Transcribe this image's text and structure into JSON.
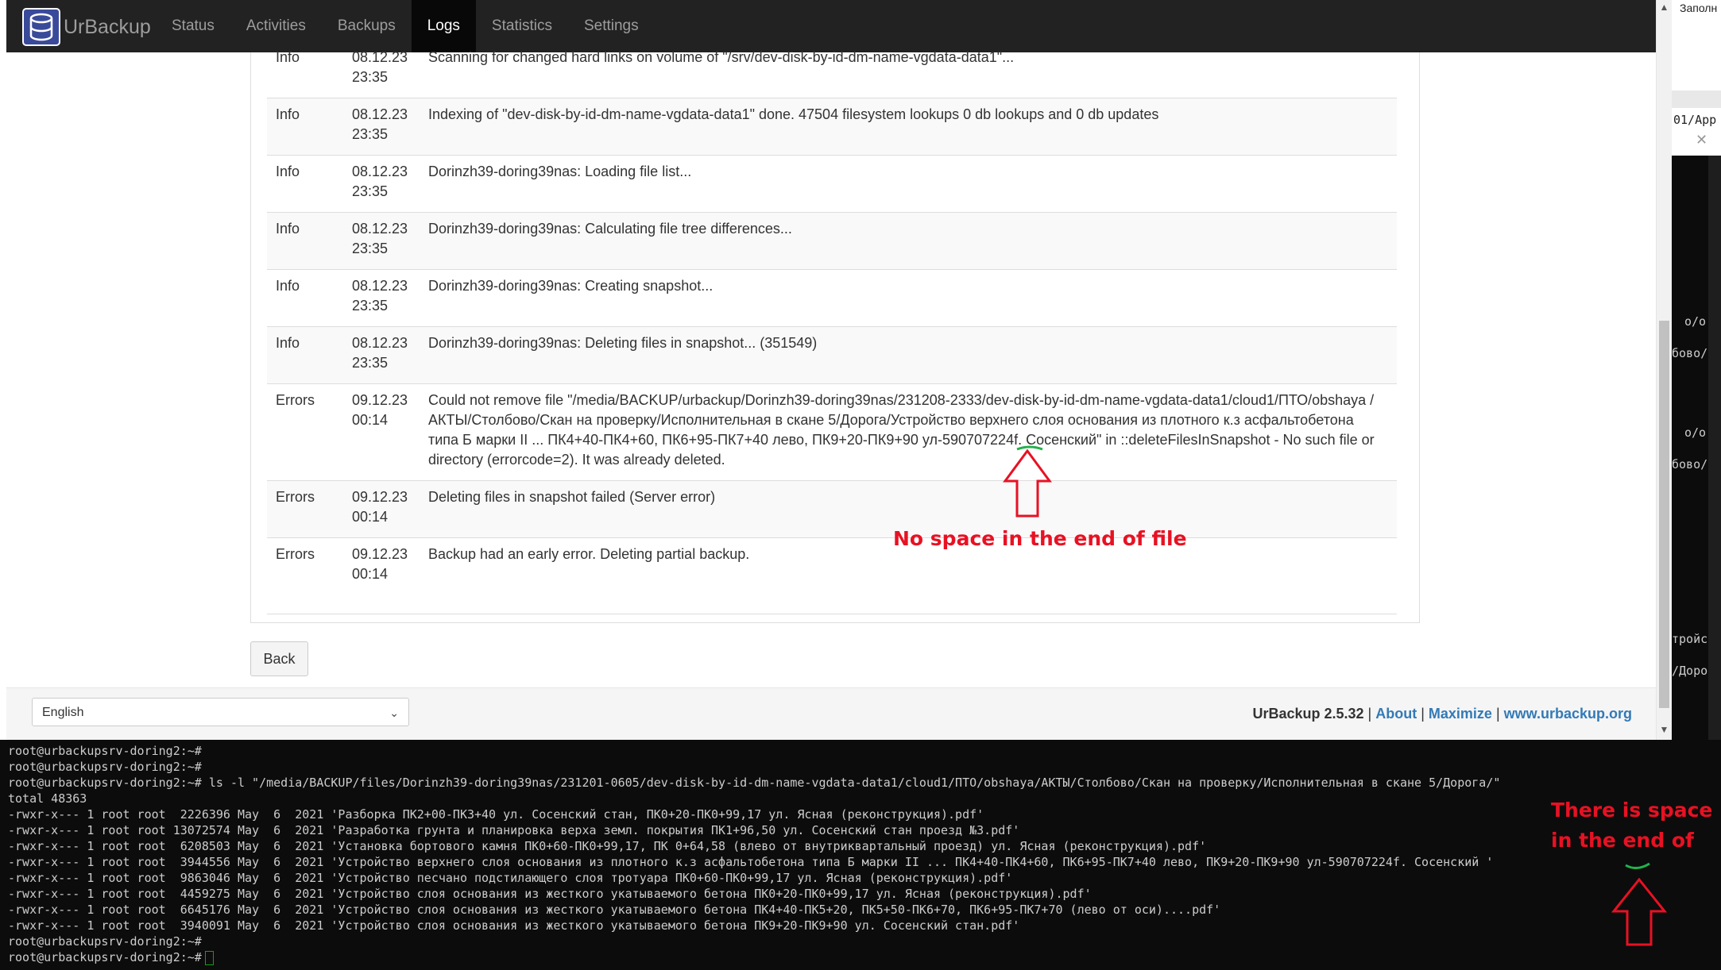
{
  "browser": {
    "brand": "UrBackup",
    "nav": [
      "Status",
      "Activities",
      "Backups",
      "Logs",
      "Statistics",
      "Settings"
    ],
    "active_nav": "Logs",
    "logs": [
      {
        "type": "Info",
        "date": "08.12.23",
        "time": "23:35",
        "message": "Scanning for changed hard links on volume of \"/srv/dev-disk-by-id-dm-name-vgdata-data1\"..."
      },
      {
        "type": "Info",
        "date": "08.12.23",
        "time": "23:35",
        "message": "Indexing of \"dev-disk-by-id-dm-name-vgdata-data1\" done. 47504 filesystem lookups 0 db lookups and 0 db updates"
      },
      {
        "type": "Info",
        "date": "08.12.23",
        "time": "23:35",
        "message": "Dorinzh39-doring39nas: Loading file list..."
      },
      {
        "type": "Info",
        "date": "08.12.23",
        "time": "23:35",
        "message": "Dorinzh39-doring39nas: Calculating file tree differences..."
      },
      {
        "type": "Info",
        "date": "08.12.23",
        "time": "23:35",
        "message": "Dorinzh39-doring39nas: Creating snapshot..."
      },
      {
        "type": "Info",
        "date": "08.12.23",
        "time": "23:35",
        "message": "Dorinzh39-doring39nas: Deleting files in snapshot... (351549)"
      },
      {
        "type": "Errors",
        "date": "09.12.23",
        "time": "00:14",
        "message": "Could not remove file \"/media/BACKUP/urbackup/Dorinzh39-doring39nas/231208-2333/dev-disk-by-id-dm-name-vgdata-data1/cloud1/ПТО/obshaya /АКТЫ/Столбово/Скан на проверку/Исполнительная в скане 5/Дорога/Устройство верхнего слоя основания из плотного к.з асфальтобетона типа Б марки II ... ПК4+40-ПК4+60, ПК6+95-ПК7+40 лево, ПК9+20-ПК9+90 ул-590707224f. Сосенский\" in ::deleteFilesInSnapshot - No such file or directory (errorcode=2). It was already deleted."
      },
      {
        "type": "Errors",
        "date": "09.12.23",
        "time": "00:14",
        "message": "Deleting files in snapshot failed (Server error)"
      },
      {
        "type": "Errors",
        "date": "09.12.23",
        "time": "00:14",
        "message": "Backup had an early error. Deleting partial backup."
      }
    ],
    "back_label": "Back",
    "language": "English",
    "footer": {
      "version": "UrBackup 2.5.32",
      "sep": " | ",
      "about": "About",
      "maximize": "Maximize",
      "site": "www.urbackup.org"
    }
  },
  "right_window": {
    "top_text": "Заполн",
    "path_text": "01/App",
    "fragments": [
      "о/о",
      "бово/",
      "о/о",
      "бово/",
      "тройс",
      "/Доро"
    ]
  },
  "terminal": {
    "lines": [
      "root@urbackupsrv-doring2:~#",
      "root@urbackupsrv-doring2:~#",
      "root@urbackupsrv-doring2:~# ls -l \"/media/BACKUP/files/Dorinzh39-doring39nas/231201-0605/dev-disk-by-id-dm-name-vgdata-data1/cloud1/ПТО/obshaya/АКТЫ/Столбово/Скан на проверку/Исполнительная в скане 5/Дорога/\"",
      "total 48363",
      "-rwxr-x--- 1 root root  2226396 May  6  2021 'Разборка ПК2+00-ПК3+40 ул. Сосенский стан, ПК0+20-ПК0+99,17 ул. Ясная (реконструкция).pdf'",
      "-rwxr-x--- 1 root root 13072574 May  6  2021 'Разработка грунта и планировка верха земл. покрытия ПК1+96,50 ул. Сосенский стан проезд №3.pdf'",
      "-rwxr-x--- 1 root root  6208503 May  6  2021 'Установка бортового камня ПК0+60-ПК0+99,17, ПК 0+64,58 (влево от внутриквартальный проезд) ул. Ясная (реконструкция).pdf'",
      "-rwxr-x--- 1 root root  3944556 May  6  2021 'Устройство верхнего слоя основания из плотного к.з асфальтобетона типа Б марки II ... ПК4+40-ПК4+60, ПК6+95-ПК7+40 лево, ПК9+20-ПК9+90 ул-590707224f. Сосенский '",
      "-rwxr-x--- 1 root root  9863046 May  6  2021 'Устройство песчано подстилающего слоя тротуара ПК0+60-ПК0+99,17 ул. Ясная (реконструкция).pdf'",
      "-rwxr-x--- 1 root root  4459275 May  6  2021 'Устройство слоя основания из жесткого укатываемого бетона ПК0+20-ПК0+99,17 ул. Ясная (реконструкция).pdf'",
      "-rwxr-x--- 1 root root  6645176 May  6  2021 'Устройство слоя основания из жесткого укатываемого бетона ПК4+40-ПК5+20, ПК5+50-ПК6+70, ПК6+95-ПК7+70 (лево от оси)....pdf'",
      "-rwxr-x--- 1 root root  3940091 May  6  2021 'Устройство слоя основания из жесткого укатываемого бетона ПК9+20-ПК9+90 ул. Сосенский стан.pdf'",
      "root@urbackupsrv-doring2:~#",
      "root@urbackupsrv-doring2:~#"
    ]
  },
  "annotations": {
    "note1": "No space in the end of file",
    "note2_line1": "There is space",
    "note2_line2": "in the end of",
    "color": "#e81123",
    "underline_color": "#22b14c"
  }
}
